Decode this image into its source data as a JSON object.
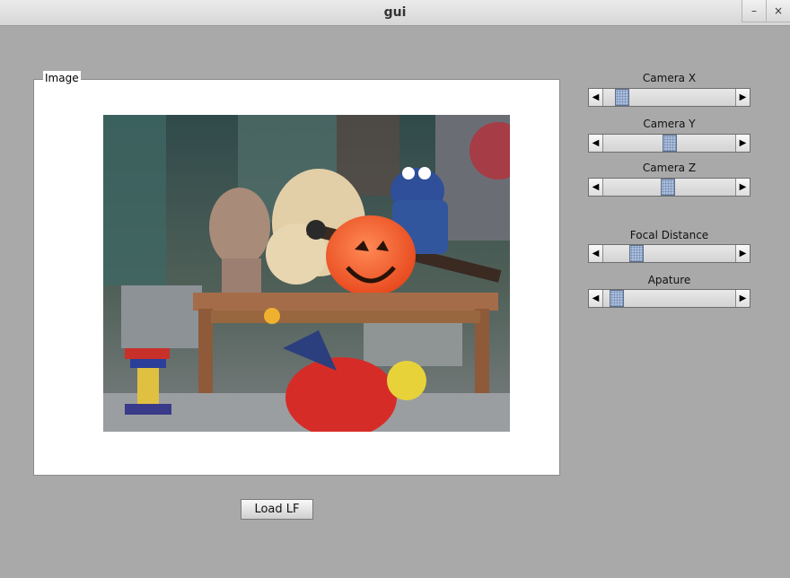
{
  "window": {
    "title": "gui",
    "minimize_label": "–",
    "close_label": "×"
  },
  "image_panel": {
    "label": "Image"
  },
  "sliders": [
    {
      "label": "Camera X",
      "value": 0.1
    },
    {
      "label": "Camera Y",
      "value": 0.5
    },
    {
      "label": "Camera Z",
      "value": 0.49
    },
    {
      "label": "Focal Distance",
      "value": 0.22
    },
    {
      "label": "Apature",
      "value": 0.05
    }
  ],
  "arrows": {
    "left": "◀",
    "right": "▶"
  },
  "load_button": {
    "label": "Load LF"
  },
  "colors": {
    "background": "#a9a9a9",
    "thumb": "#b9cbe6"
  }
}
